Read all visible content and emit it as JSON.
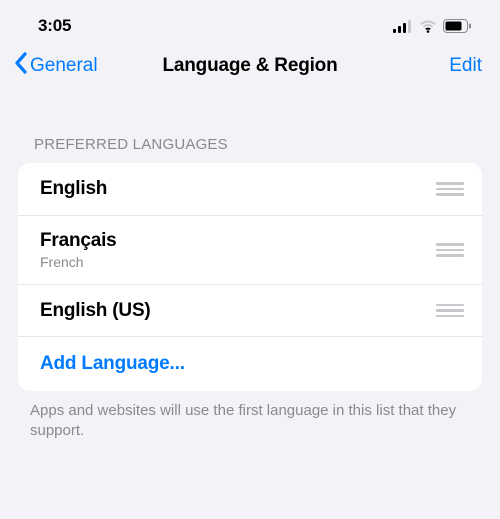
{
  "status": {
    "time": "3:05"
  },
  "nav": {
    "back_label": "General",
    "title": "Language & Region",
    "edit_label": "Edit"
  },
  "languages": {
    "header": "Preferred Languages",
    "items": [
      {
        "title": "English",
        "subtitle": ""
      },
      {
        "title": "Français",
        "subtitle": "French"
      },
      {
        "title": "English (US)",
        "subtitle": ""
      }
    ],
    "add_label": "Add Language...",
    "footer": "Apps and websites will use the first language in this list that they support."
  },
  "colors": {
    "accent": "#007aff",
    "background": "#f2f2f7",
    "separator": "#e5e5ea",
    "secondary_text": "#8a8a8e"
  }
}
